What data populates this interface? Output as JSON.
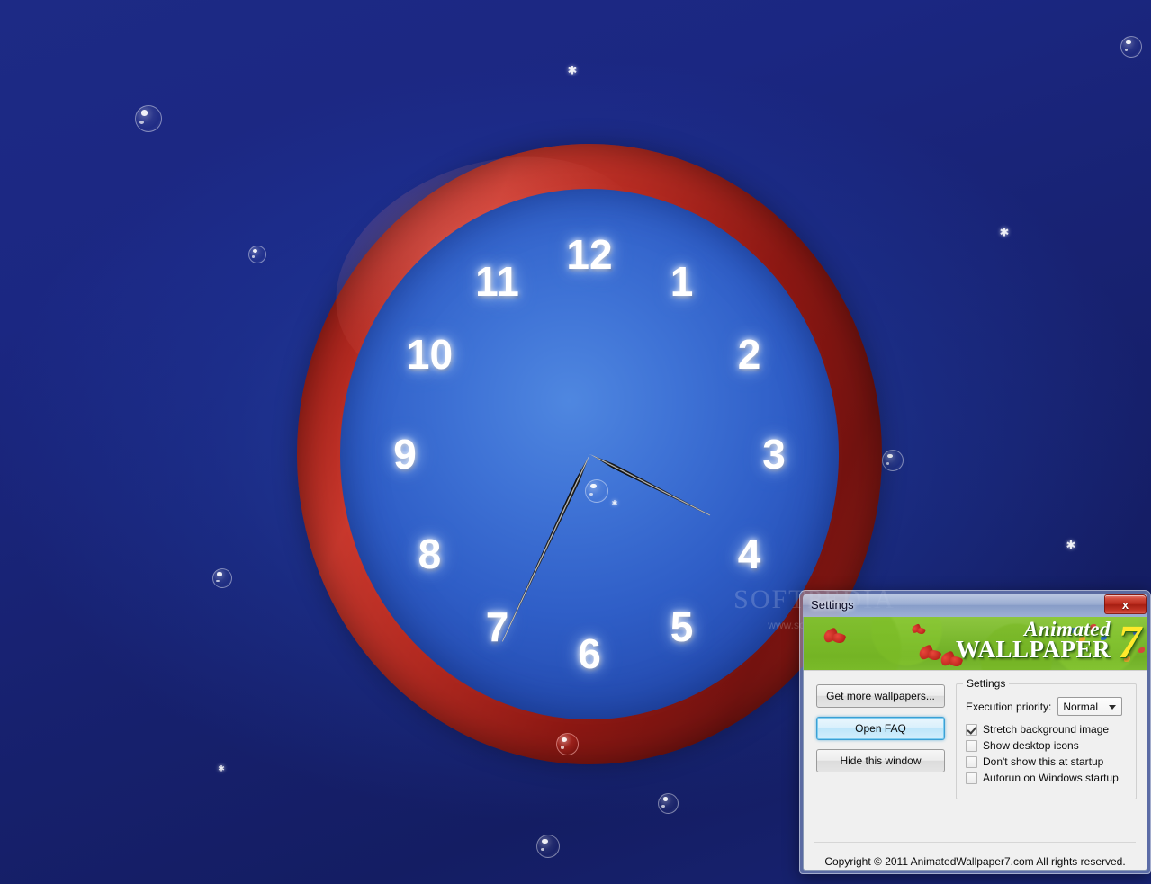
{
  "desktop": {
    "watermark_main": "SOFTPEDIA",
    "watermark_sub": "www.softpedia.com"
  },
  "clock": {
    "numerals": [
      "12",
      "1",
      "2",
      "3",
      "4",
      "5",
      "6",
      "7",
      "8",
      "9",
      "10",
      "11"
    ],
    "hour_hand_deg": 117,
    "minute_hand_deg": 205
  },
  "dialog": {
    "title": "Settings",
    "close_label": "x",
    "banner": {
      "logo_line1": "Animated",
      "logo_line2": "WALLPAPER",
      "logo_seven": "7"
    },
    "buttons": [
      {
        "label": "Get more wallpapers...",
        "focused": false
      },
      {
        "label": "Open FAQ",
        "focused": true
      },
      {
        "label": "Hide this window",
        "focused": false
      }
    ],
    "settings_group": {
      "legend": "Settings",
      "priority_label": "Execution priority:",
      "priority_value": "Normal",
      "priority_options": [
        "Normal"
      ],
      "checkboxes": [
        {
          "label": "Stretch background image",
          "checked": true
        },
        {
          "label": "Show desktop icons",
          "checked": false
        },
        {
          "label": "Don't show this at startup",
          "checked": false
        },
        {
          "label": "Autorun on Windows startup",
          "checked": false
        }
      ]
    },
    "footer": {
      "copyright": "Copyright © 2011 AnimatedWallpaper7.com All rights reserved."
    }
  },
  "colors": {
    "desktop_blue": "#1d2a85",
    "clock_rim_red": "#a8231b",
    "clock_face_blue": "#3f73d6",
    "banner_green": "#7ab82e",
    "logo_yellow": "#ffe92b",
    "close_red": "#b8291b",
    "focus_blue": "#3c9fd4"
  }
}
